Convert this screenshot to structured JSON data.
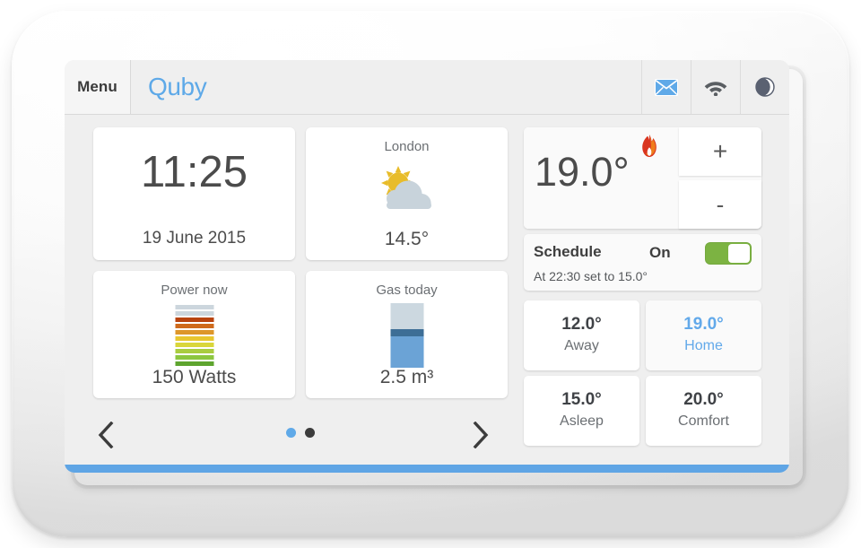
{
  "device": {
    "name": "quby-thermostat-display"
  },
  "topbar": {
    "menu_label": "Menu",
    "brand": "Quby",
    "icons": [
      {
        "name": "mail-icon",
        "glyph": "envelope"
      },
      {
        "name": "wifi-icon",
        "glyph": "wifi"
      },
      {
        "name": "brightness-moon-icon",
        "glyph": "moon"
      }
    ]
  },
  "tiles": {
    "clock": {
      "time": "11:25",
      "date": "19 June 2015"
    },
    "weather": {
      "city": "London",
      "temperature": "14.5°",
      "condition_icon": "partly-cloudy-icon"
    },
    "power": {
      "title": "Power now",
      "value": "150 Watts",
      "gauge_icon": "power-bar-gauge-icon"
    },
    "gas": {
      "title": "Gas today",
      "value": "2.5 m³",
      "gauge_icon": "gas-bar-gauge-icon"
    }
  },
  "thermostat": {
    "setpoint": "19.0°",
    "heating_icon": "flame-icon",
    "increase_label": "+",
    "decrease_label": "-"
  },
  "schedule": {
    "label": "Schedule",
    "state": "On",
    "toggle_on": true,
    "note": "At 22:30 set to 15.0°"
  },
  "presets": [
    {
      "temperature": "12.0°",
      "name": "Away",
      "active": false
    },
    {
      "temperature": "19.0°",
      "name": "Home",
      "active": true
    },
    {
      "temperature": "15.0°",
      "name": "Asleep",
      "active": false
    },
    {
      "temperature": "20.0°",
      "name": "Comfort",
      "active": false
    }
  ],
  "navigation": {
    "prev_icon": "chevron-left-icon",
    "next_icon": "chevron-right-icon",
    "pages": 2,
    "current_page": 1
  },
  "colors": {
    "brand_blue": "#5ea9e8",
    "accent_blue": "#62a9ea",
    "toggle_green": "#7cb342",
    "bottom_bar": "#5fa5e5",
    "screen_bg": "#efefef",
    "tile_bg": "#ffffff",
    "sun_yellow": "#e8bc2a",
    "cloud_gray": "#c8d3db",
    "flame_orange": "#ef6b23",
    "flame_red": "#c9272d"
  },
  "gauges": {
    "power_segments": [
      "#ccd6dd",
      "#ccd6dd",
      "#b8430f",
      "#cf6a1c",
      "#dd962a",
      "#e8c62f",
      "#d9d63a",
      "#a9cc3f",
      "#8cc63f",
      "#5ea52f"
    ],
    "gas_segments": [
      {
        "color": "#ccd8e0",
        "pct": 40
      },
      {
        "color": "#3d6e96",
        "pct": 12
      },
      {
        "color": "#6ba3d6",
        "pct": 48
      }
    ]
  }
}
